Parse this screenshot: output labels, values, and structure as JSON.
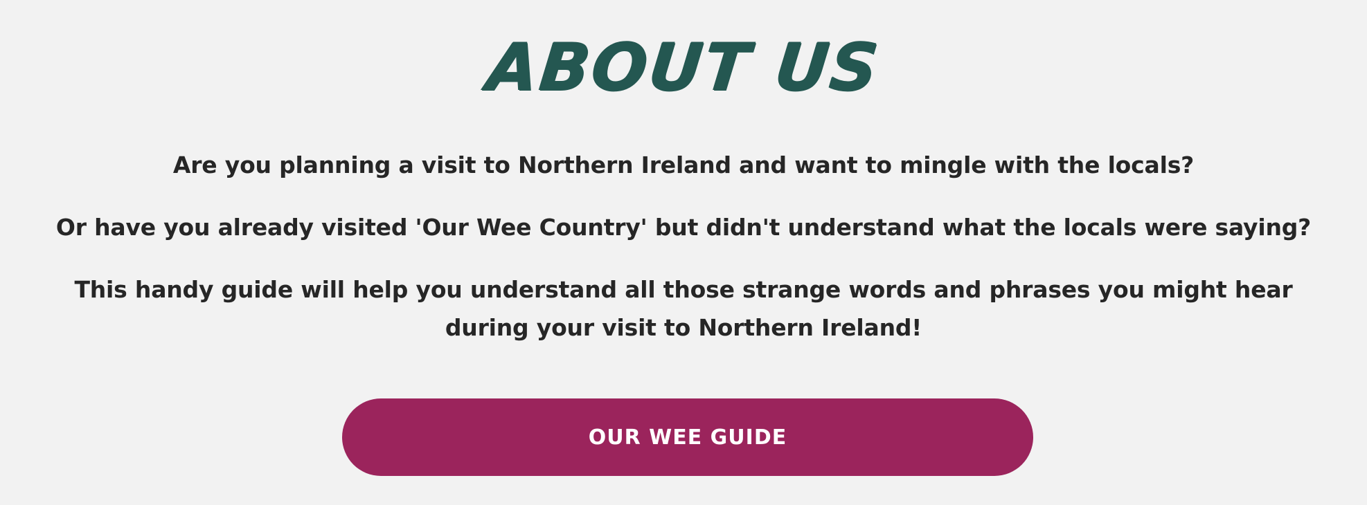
{
  "about": {
    "title": "ABOUT US",
    "paragraphs": [
      "Are you planning a visit to Northern Ireland and want to mingle with the locals?",
      "Or have you already visited 'Our Wee Country' but didn't understand what the locals were saying?",
      "This handy guide will help you understand all those strange words and phrases you might hear during your visit to Northern Ireland!"
    ],
    "button_label": "OUR WEE GUIDE"
  },
  "colors": {
    "background": "#f2f2f2",
    "title": "#245751",
    "text": "#262626",
    "button": "#9b245c",
    "button_text": "#ffffff"
  }
}
